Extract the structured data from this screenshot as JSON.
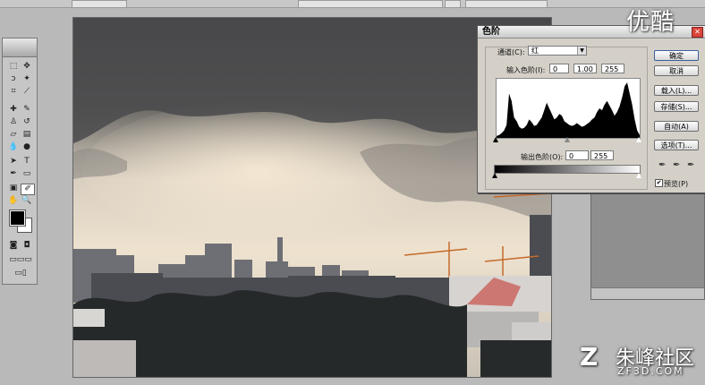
{
  "watermark": {
    "top_text": "优酷",
    "brand_name": "朱峰社区",
    "brand_site": "ZF3D.COM"
  },
  "levels_dialog": {
    "title": "色阶",
    "channel_label": "通道(C):",
    "channel_value": "红",
    "input_levels_label": "输入色阶(I):",
    "input_black": "0",
    "input_gamma": "1.00",
    "input_white": "255",
    "output_levels_label": "输出色阶(O):",
    "output_black": "0",
    "output_white": "255",
    "buttons": {
      "ok": "确定",
      "cancel": "取消",
      "load": "载入(L)...",
      "save": "存储(S)...",
      "auto": "自动(A)",
      "options": "选项(T)..."
    },
    "preview_label": "预览(P)",
    "preview_checked": true
  },
  "histogram": [
    2,
    3,
    5,
    8,
    14,
    48,
    40,
    22,
    18,
    12,
    10,
    11,
    14,
    20,
    17,
    13,
    14,
    18,
    22,
    30,
    38,
    32,
    26,
    20,
    22,
    26,
    24,
    18,
    16,
    14,
    13,
    14,
    16,
    14,
    12,
    13,
    15,
    17,
    20,
    22,
    28,
    32,
    30,
    36,
    40,
    35,
    30,
    24,
    28,
    34,
    44,
    56,
    60,
    48,
    36,
    20,
    8,
    3
  ]
}
